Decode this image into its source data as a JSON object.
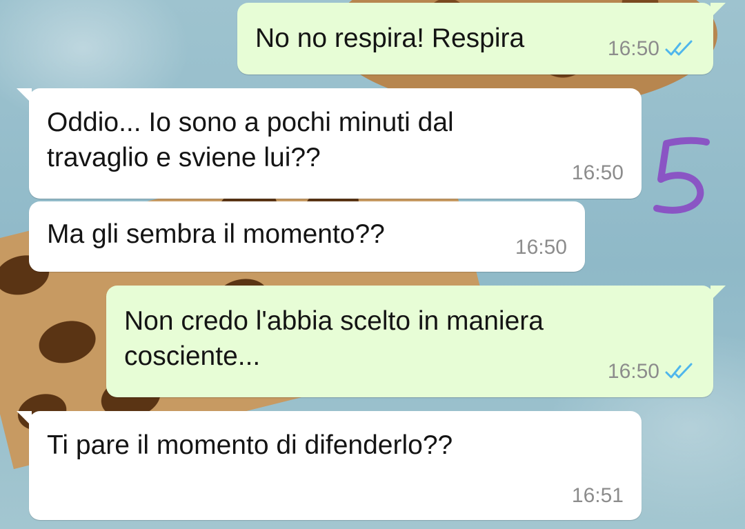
{
  "chat": {
    "messages": [
      {
        "direction": "outgoing",
        "text": "No no respira! Respira",
        "time": "16:50",
        "status": "read"
      },
      {
        "direction": "incoming",
        "text": "Oddio... Io sono a pochi minuti dal\ntravaglio e sviene lui??",
        "time": "16:50"
      },
      {
        "direction": "incoming",
        "text": "Ma gli sembra il momento??",
        "time": "16:50"
      },
      {
        "direction": "outgoing",
        "text": "Non credo l'abbia scelto in maniera\ncosciente...",
        "time": "16:50",
        "status": "read"
      },
      {
        "direction": "incoming",
        "text": "Ti pare il momento di difenderlo??",
        "time": "16:51"
      }
    ]
  },
  "annotation": {
    "text": "5",
    "color": "#8a55c4"
  },
  "colors": {
    "incoming_bubble": "#ffffff",
    "outgoing_bubble": "#e7fdd6",
    "timestamp": "#8c8c8c",
    "read_ticks": "#4fb6ec"
  },
  "icons": {
    "read_receipt": "double-check-icon"
  }
}
